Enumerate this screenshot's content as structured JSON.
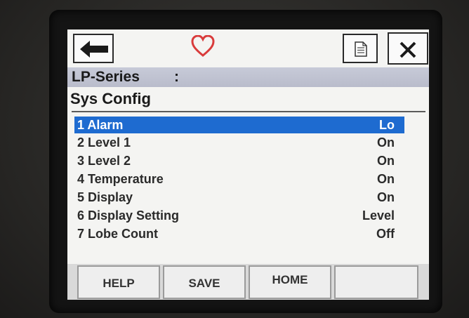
{
  "header": {
    "back_icon": "arrow-left-icon",
    "favorite_icon": "heart-outline-icon",
    "favorite_color": "#d93b3b",
    "doc_icon": "document-icon",
    "close_icon": "close-x-icon"
  },
  "device_title": {
    "name": "LP-Series",
    "separator": ":"
  },
  "page_title": "Sys Config",
  "menu": {
    "selected_index": 0,
    "selected_color": "#1e6bd0",
    "items": [
      {
        "label": "1 Alarm",
        "value": "Lo"
      },
      {
        "label": "2 Level 1",
        "value": "On"
      },
      {
        "label": "3 Level 2",
        "value": "On"
      },
      {
        "label": "4 Temperature",
        "value": "On"
      },
      {
        "label": "5 Display",
        "value": "On"
      },
      {
        "label": "6 Display Setting",
        "value": "Level"
      },
      {
        "label": "7 Lobe Count",
        "value": "Off"
      }
    ]
  },
  "softkeys": {
    "help": "HELP",
    "save": "SAVE",
    "home": "HOME",
    "fourth": ""
  }
}
